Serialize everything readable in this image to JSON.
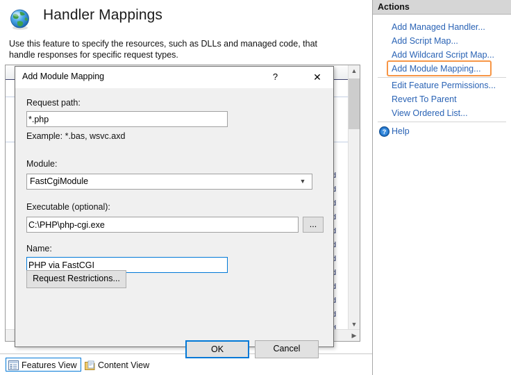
{
  "page": {
    "title": "Handler Mappings",
    "description": "Use this feature to specify the resources, such as DLLs and managed code, that handle responses for specific request types.",
    "icon": "globe-icon"
  },
  "list": {
    "hidden_cell_text": "d",
    "rows": 12
  },
  "view_bar": {
    "features_view": "Features View",
    "content_view": "Content View"
  },
  "actions": {
    "title": "Actions",
    "items": [
      {
        "label": "Add Managed Handler...",
        "highlighted": false
      },
      {
        "label": "Add Script Map...",
        "highlighted": false
      },
      {
        "label": "Add Wildcard Script Map...",
        "highlighted": false
      },
      {
        "label": "Add Module Mapping...",
        "highlighted": true
      },
      {
        "label": "Edit Feature Permissions...",
        "highlighted": false
      },
      {
        "label": "Revert To Parent",
        "highlighted": false
      },
      {
        "label": "View Ordered List...",
        "highlighted": false
      }
    ],
    "help_label": "Help",
    "help_icon": "help-circle-icon",
    "highlight_color": "#f79646",
    "link_color": "#2a63b5"
  },
  "dialog": {
    "title": "Add Module Mapping",
    "help_button": "?",
    "close_button": "✕",
    "request_path": {
      "label": "Request path:",
      "value": "*.php",
      "placeholder": "",
      "hint": "Example: *.bas, wsvc.axd"
    },
    "module": {
      "label": "Module:",
      "value": "FastCgiModule"
    },
    "executable": {
      "label": "Executable (optional):",
      "value": "C:\\PHP\\php-cgi.exe",
      "placeholder": "",
      "browse_label": "..."
    },
    "name": {
      "label": "Name:",
      "value": "PHP via FastCGI",
      "placeholder": ""
    },
    "request_restrictions_label": "Request Restrictions...",
    "ok_label": "OK",
    "cancel_label": "Cancel",
    "accent_color": "#0078d7"
  }
}
